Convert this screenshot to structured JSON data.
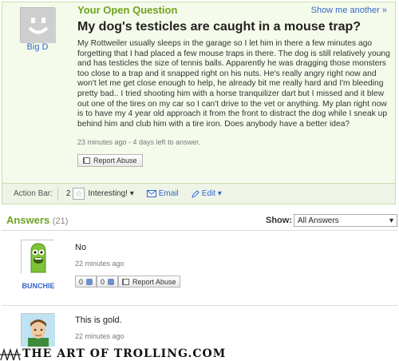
{
  "question": {
    "header": "Your Open Question",
    "show_more": "Show me another »",
    "author": "Big D",
    "title": "My dog's testicles are caught in a mouse trap?",
    "body": "My Rottweiler usually sleeps in the garage so I let him in there a few minutes ago forgetting that I had placed a few mouse traps in there. The dog is still relatively young and has testicles the size of tennis balls. Apparently he was dragging those monsters too close to a trap and it snapped right on his nuts. He's really angry right now and won't let me get close enough to help, he already bit me really hard and I'm bleeding pretty bad.. I tried shooting him with a horse tranquilizer dart but I missed and it blew out one of the tires on my car so I can't drive to the vet or anything. My plan right now is to have my 4 year old approach it from the front to distract the dog while I sneak up behind him and club him with a tire iron. Does anybody have a better idea?",
    "meta": "23 minutes ago - 4 days left to answer.",
    "report_label": "Report Abuse"
  },
  "action_bar": {
    "label": "Action Bar:",
    "interesting_count": "2",
    "interesting_label": "Interesting! ▾",
    "email_label": "Email",
    "edit_label": "Edit ▾"
  },
  "answers": {
    "header": "Answers",
    "count": "(21)",
    "show_label": "Show:",
    "show_value": "All Answers",
    "items": [
      {
        "author": "BUNCHIE",
        "text": "No",
        "meta": "22 minutes ago",
        "thumbs_up": "0",
        "thumbs_down": "0",
        "report_label": "Report Abuse"
      },
      {
        "author": "",
        "text": "This is gold.",
        "meta": "22 minutes ago"
      }
    ]
  },
  "watermark": "THE ART OF TROLLING.COM",
  "colors": {
    "accent_green": "#6fa322",
    "link_blue": "#3366cc",
    "question_bg": "#f5fbea"
  }
}
